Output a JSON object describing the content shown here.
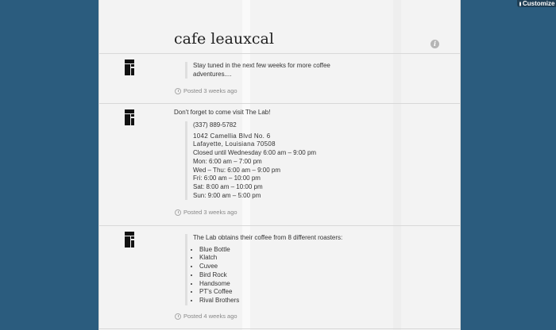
{
  "top_bar": {
    "customize_label": "Customize"
  },
  "blog": {
    "title": "cafe leauxcal"
  },
  "posts": [
    {
      "quote_lines": [
        "Stay tuned in the next few weeks for more coffee",
        "adventures...."
      ],
      "meta": "Posted 3 weeks ago"
    },
    {
      "text": "Don't forget to come visit The Lab!",
      "quote_lines": [
        "(337) 889-5782",
        "1042 Camellia Blvd No. 6",
        "Lafayette, Louisiana 70508",
        "Closed until Wednesday 6:00 am – 9:00 pm",
        "Mon: 6:00 am – 7:00 pm",
        "Wed – Thu: 6:00 am – 9:00 pm",
        "Fri: 6:00 am – 10:00 pm",
        "Sat: 8:00 am – 10:00 pm",
        "Sun: 9:00 am – 5:00 pm"
      ],
      "meta": "Posted 3 weeks ago"
    },
    {
      "quote_intro": "The Lab obtains their coffee from 8 different roasters:",
      "roasters": [
        "Blue Bottle",
        "Klatch",
        "Cuvee",
        "Bird Rock",
        "Handsome",
        "PT's Coffee",
        "Rival Brothers"
      ],
      "meta": "Posted 4 weeks ago"
    }
  ]
}
